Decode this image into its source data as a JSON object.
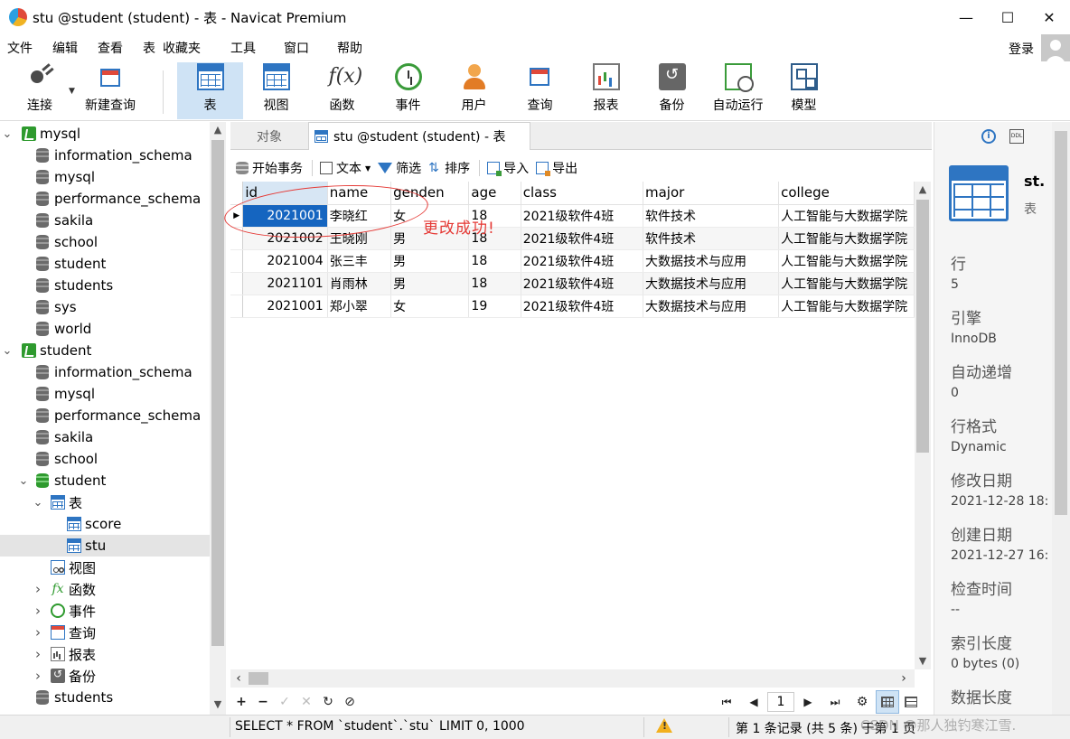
{
  "window": {
    "title": "stu @student (student) - 表 - Navicat Premium",
    "minimize": "—",
    "maximize": "☐",
    "close": "✕"
  },
  "menu": {
    "items": [
      "文件",
      "编辑",
      "查看",
      "表",
      "收藏夹",
      "工具",
      "窗口",
      "帮助"
    ],
    "login": "登录"
  },
  "toolbar": {
    "buttons": [
      {
        "label": "连接",
        "icon": "plug-icon"
      },
      {
        "label": "新建查询",
        "icon": "new-query-icon"
      },
      {
        "label": "表",
        "icon": "table-icon",
        "active": true
      },
      {
        "label": "视图",
        "icon": "view-icon"
      },
      {
        "label": "函数",
        "icon": "function-icon"
      },
      {
        "label": "事件",
        "icon": "clock-icon"
      },
      {
        "label": "用户",
        "icon": "user-icon"
      },
      {
        "label": "查询",
        "icon": "query-icon"
      },
      {
        "label": "报表",
        "icon": "report-icon"
      },
      {
        "label": "备份",
        "icon": "backup-icon"
      },
      {
        "label": "自动运行",
        "icon": "auto-run-icon"
      },
      {
        "label": "模型",
        "icon": "model-icon"
      }
    ]
  },
  "nav": {
    "items": [
      {
        "label": "mysql",
        "type": "connection",
        "level": 0,
        "expanded": true
      },
      {
        "label": "information_schema",
        "type": "database",
        "level": 1
      },
      {
        "label": "mysql",
        "type": "database",
        "level": 1
      },
      {
        "label": "performance_schema",
        "type": "database",
        "level": 1
      },
      {
        "label": "sakila",
        "type": "database",
        "level": 1
      },
      {
        "label": "school",
        "type": "database",
        "level": 1
      },
      {
        "label": "student",
        "type": "database",
        "level": 1
      },
      {
        "label": "students",
        "type": "database",
        "level": 1
      },
      {
        "label": "sys",
        "type": "database",
        "level": 1
      },
      {
        "label": "world",
        "type": "database",
        "level": 1
      },
      {
        "label": "student",
        "type": "connection",
        "level": 0,
        "expanded": true
      },
      {
        "label": "information_schema",
        "type": "database",
        "level": 1
      },
      {
        "label": "mysql",
        "type": "database",
        "level": 1
      },
      {
        "label": "performance_schema",
        "type": "database",
        "level": 1
      },
      {
        "label": "sakila",
        "type": "database",
        "level": 1
      },
      {
        "label": "school",
        "type": "database",
        "level": 1
      },
      {
        "label": "student",
        "type": "database-open",
        "level": 1,
        "expanded": true
      },
      {
        "label": "表",
        "type": "tables",
        "level": 2,
        "expanded": true
      },
      {
        "label": "score",
        "type": "table",
        "level": 3
      },
      {
        "label": "stu",
        "type": "table",
        "level": 3,
        "selected": true
      },
      {
        "label": "视图",
        "type": "views",
        "level": 2
      },
      {
        "label": "函数",
        "type": "functions",
        "level": 2,
        "collapsed": true
      },
      {
        "label": "事件",
        "type": "events",
        "level": 2,
        "collapsed": true
      },
      {
        "label": "查询",
        "type": "queries",
        "level": 2,
        "collapsed": true
      },
      {
        "label": "报表",
        "type": "reports",
        "level": 2,
        "collapsed": true
      },
      {
        "label": "备份",
        "type": "backups",
        "level": 2,
        "collapsed": true
      },
      {
        "label": "students",
        "type": "database",
        "level": 1
      }
    ]
  },
  "tabs": {
    "objects": "对象",
    "active": "stu @student (student) - 表"
  },
  "data_toolbar": {
    "begin_transaction": "开始事务",
    "text": "文本",
    "filter": "筛选",
    "sort": "排序",
    "import": "导入",
    "export": "导出"
  },
  "grid": {
    "columns": [
      "id",
      "name",
      "genden",
      "age",
      "class",
      "major",
      "college"
    ],
    "rows": [
      [
        "2021001",
        "李晓红",
        "女",
        "18",
        "2021级软件4班",
        "软件技术",
        "人工智能与大数据学院"
      ],
      [
        "2021002",
        "王晓刚",
        "男",
        "18",
        "2021级软件4班",
        "软件技术",
        "人工智能与大数据学院"
      ],
      [
        "2021004",
        "张三丰",
        "男",
        "18",
        "2021级软件4班",
        "大数据技术与应用",
        "人工智能与大数据学院"
      ],
      [
        "2021101",
        "肖雨林",
        "男",
        "18",
        "2021级软件4班",
        "大数据技术与应用",
        "人工智能与大数据学院"
      ],
      [
        "2021001",
        "郑小翠",
        "女",
        "19",
        "2021级软件4班",
        "大数据技术与应用",
        "人工智能与大数据学院"
      ]
    ]
  },
  "annotation": {
    "text": "更改成功!"
  },
  "pager": {
    "page": "1"
  },
  "status": {
    "sql": "SELECT * FROM `student`.`stu` LIMIT 0, 1000",
    "records": "第 1 条记录 (共 5 条) 于第 1 页",
    "watermark": "CSDN @那人独钓寒江雪."
  },
  "info": {
    "name": "st.",
    "type": "表",
    "properties": [
      {
        "label": "行",
        "value": "5"
      },
      {
        "label": "引擎",
        "value": "InnoDB"
      },
      {
        "label": "自动递增",
        "value": "0"
      },
      {
        "label": "行格式",
        "value": "Dynamic"
      },
      {
        "label": "修改日期",
        "value": "2021-12-28 18:"
      },
      {
        "label": "创建日期",
        "value": "2021-12-27 16:"
      },
      {
        "label": "检查时间",
        "value": "--"
      },
      {
        "label": "索引长度",
        "value": "0 bytes (0)"
      },
      {
        "label": "数据长度",
        "value": ""
      }
    ]
  },
  "colors": {
    "accent": "#2e75c2",
    "selection": "#1565c0",
    "annotation": "#e53935",
    "active_toolbar": "#cfe3f5"
  }
}
